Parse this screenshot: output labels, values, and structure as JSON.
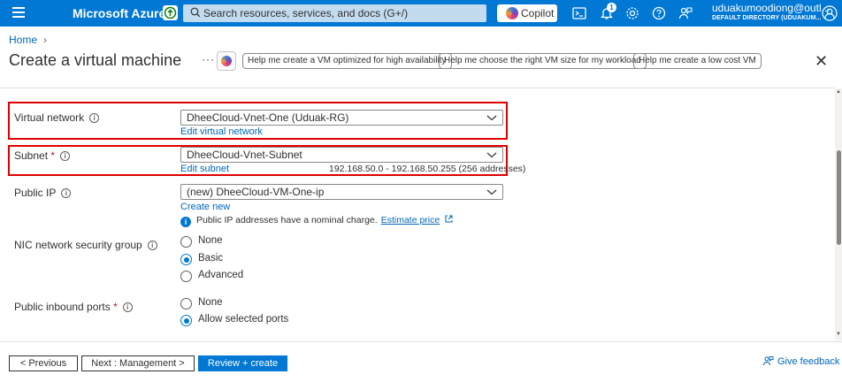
{
  "topbar": {
    "brand": "Microsoft Azure",
    "search_placeholder": "Search resources, services, and docs (G+/)",
    "copilot_label": "Copilot",
    "notification_count": "1",
    "account_email": "uduakumoodiong@outl...",
    "account_directory": "DEFAULT DIRECTORY (UDUAKUM...",
    "accent_color": "#0078d4"
  },
  "header": {
    "breadcrumb_home": "Home",
    "title": "Create a virtual machine",
    "more_label": "···",
    "suggestions": [
      "Help me create a VM optimized for high availability",
      "Help me choose the right VM size for my workload",
      "Help me create a low cost VM"
    ],
    "close_label": "✕"
  },
  "form": {
    "virtual_network": {
      "label": "Virtual network",
      "value": "DheeCloud-Vnet-One (Uduak-RG)",
      "edit_link": "Edit virtual network"
    },
    "subnet": {
      "label": "Subnet",
      "required": "*",
      "value": "DheeCloud-Vnet-Subnet",
      "edit_link": "Edit subnet",
      "range": "192.168.50.0 - 192.168.50.255 (256 addresses)"
    },
    "public_ip": {
      "label": "Public IP",
      "value": "(new) DheeCloud-VM-One-ip",
      "create_link": "Create new",
      "note": "Public IP addresses have a nominal charge.",
      "note_link": "Estimate price"
    },
    "nic_nsg": {
      "label": "NIC network security group",
      "options": [
        "None",
        "Basic",
        "Advanced"
      ],
      "selected": "Basic"
    },
    "inbound_ports": {
      "label": "Public inbound ports",
      "required": "*",
      "options": [
        "None",
        "Allow selected ports"
      ],
      "selected": "Allow selected ports"
    },
    "highlight_color": "#e00000"
  },
  "footer": {
    "previous": "< Previous",
    "next": "Next : Management >",
    "review": "Review + create",
    "feedback": "Give feedback"
  }
}
